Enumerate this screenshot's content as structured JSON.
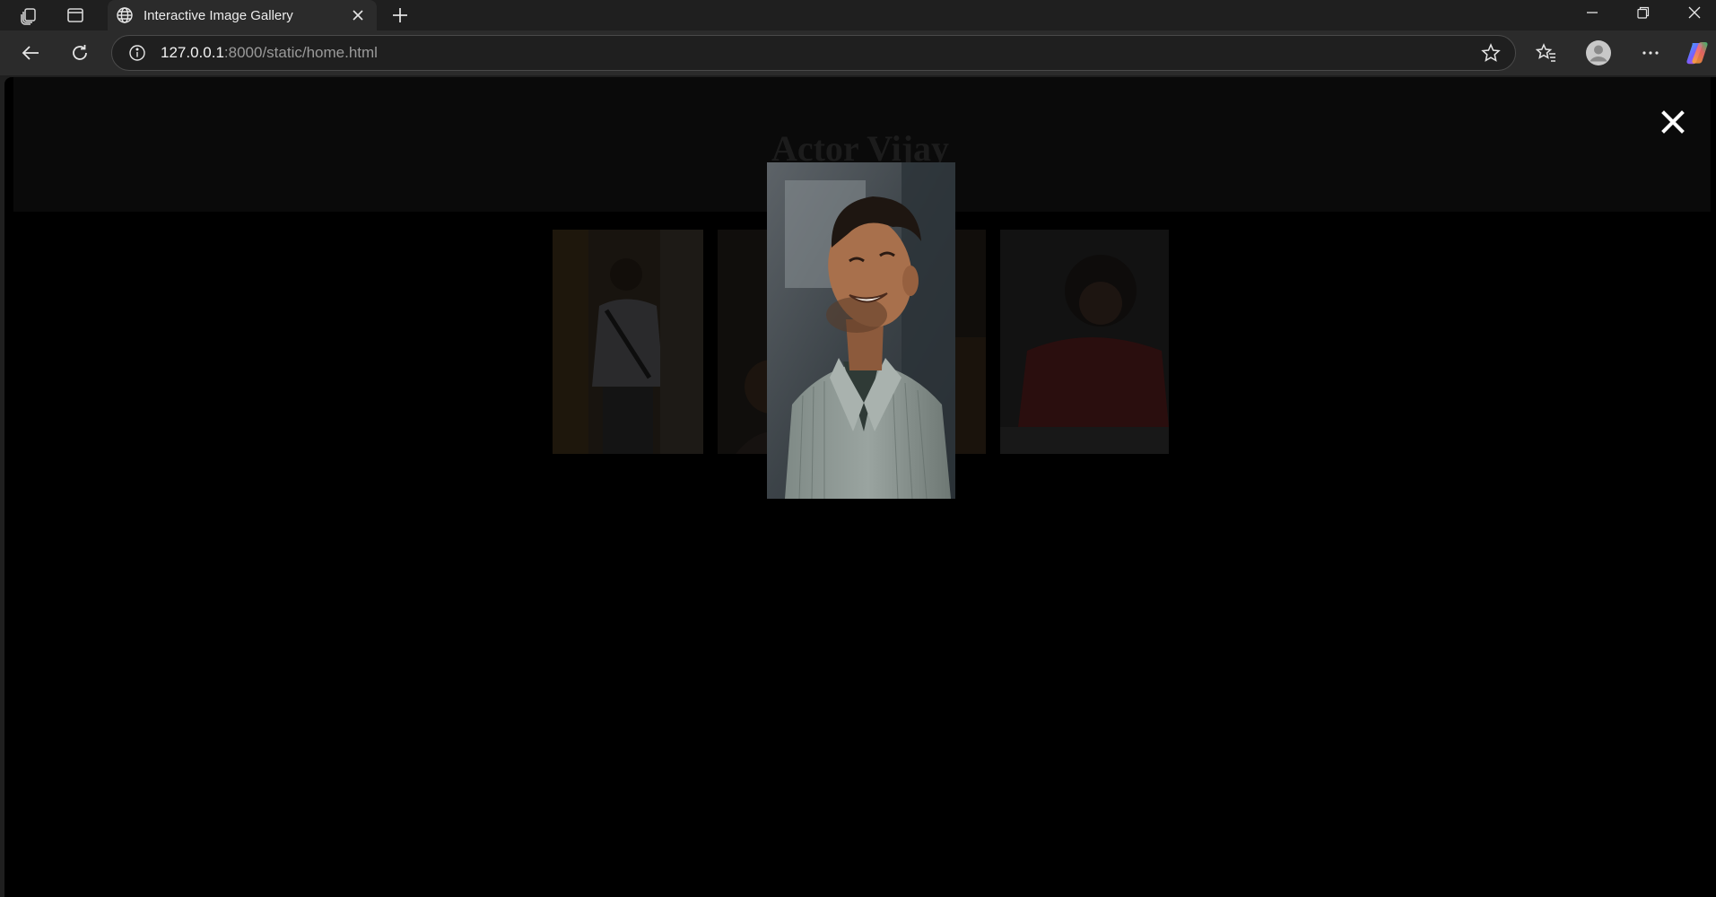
{
  "browser": {
    "tab": {
      "title": "Interactive Image Gallery",
      "favicon": "globe-icon"
    },
    "address": {
      "host": "127.0.0.1",
      "path": ":8000/static/home.html"
    }
  },
  "page": {
    "title": "Actor Vijay",
    "close_symbol": "✕",
    "thumbnails": [
      {
        "name": "photo-1",
        "alt": "Actor Vijay photo 1"
      },
      {
        "name": "photo-2",
        "alt": "Actor Vijay photo 2"
      },
      {
        "name": "photo-3",
        "alt": "Actor Vijay photo 3"
      },
      {
        "name": "photo-4",
        "alt": "Actor Vijay photo 4"
      }
    ],
    "lightbox": {
      "alt": "Actor Vijay enlarged photo"
    }
  }
}
